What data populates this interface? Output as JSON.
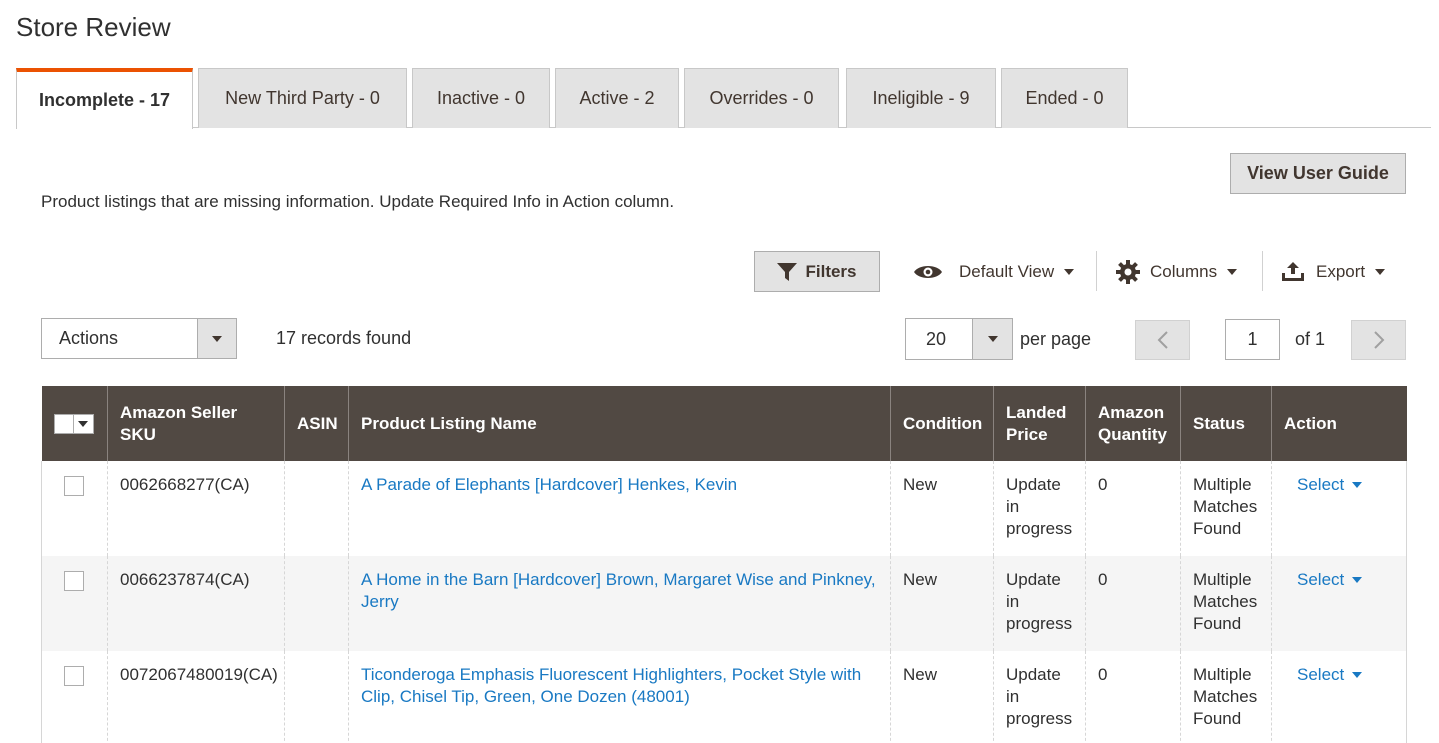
{
  "page": {
    "title": "Store Review"
  },
  "tabs": [
    {
      "label": "Incomplete - 17",
      "active": true
    },
    {
      "label": "New Third Party - 0"
    },
    {
      "label": "Inactive - 0"
    },
    {
      "label": "Active - 2"
    },
    {
      "label": "Overrides - 0"
    },
    {
      "label": "Ineligible - 9"
    },
    {
      "label": "Ended - 0"
    }
  ],
  "guide_button": "View User Guide",
  "description": "Product listings that are missing information. Update Required Info in Action column.",
  "toolbar": {
    "filters": "Filters",
    "view": "Default View",
    "columns": "Columns",
    "export": "Export"
  },
  "mass_actions": {
    "label": "Actions"
  },
  "records_found": "17 records found",
  "pagination": {
    "per_page_value": "20",
    "per_page_label": "per page",
    "current_page": "1",
    "of_label": "of 1"
  },
  "columns": [
    "Amazon Seller SKU",
    "ASIN",
    "Product Listing Name",
    "Condition",
    "Landed Price",
    "Amazon Quantity",
    "Status",
    "Action"
  ],
  "rows": [
    {
      "sku": "0062668277(CA)",
      "asin": "",
      "name": "A Parade of Elephants [Hardcover] Henkes, Kevin",
      "condition": "New",
      "price": "Update in progress",
      "qty": "0",
      "status": "Multiple Matches Found",
      "action": "Select"
    },
    {
      "sku": "0066237874(CA)",
      "asin": "",
      "name": "A Home in the Barn [Hardcover] Brown, Margaret Wise and Pinkney, Jerry",
      "condition": "New",
      "price": "Update in progress",
      "qty": "0",
      "status": "Multiple Matches Found",
      "action": "Select"
    },
    {
      "sku": "0072067480019(CA)",
      "asin": "",
      "name": "Ticonderoga Emphasis Fluorescent Highlighters, Pocket Style with Clip, Chisel Tip, Green, One Dozen (48001)",
      "condition": "New",
      "price": "Update in progress",
      "qty": "0",
      "status": "Multiple Matches Found",
      "action": "Select"
    }
  ],
  "colors": {
    "header_bg": "#514943",
    "accent": "#eb5202",
    "link": "#1979c3"
  }
}
